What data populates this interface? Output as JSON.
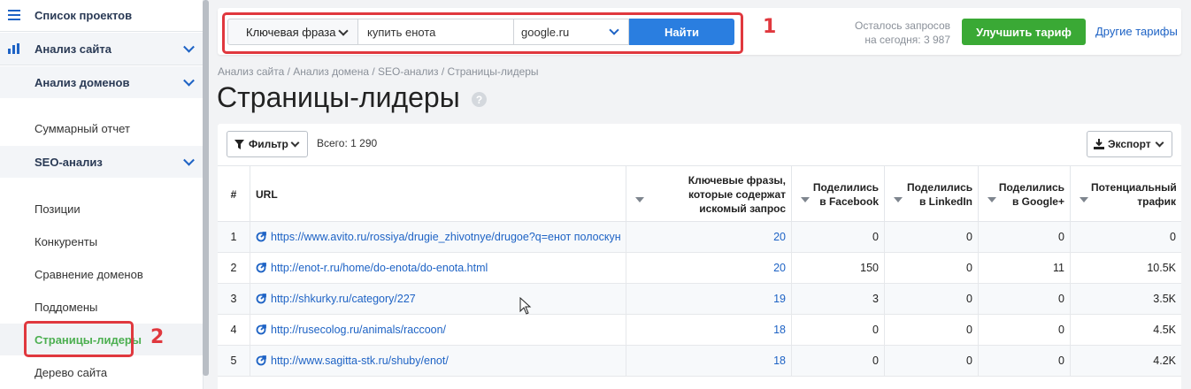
{
  "sidebar": {
    "projects": "Список проектов",
    "site_analysis": "Анализ сайта",
    "domain_analysis": "Анализ доменов",
    "summary": "Суммарный отчет",
    "seo_analysis": "SEO-анализ",
    "positions": "Позиции",
    "competitors": "Конкуренты",
    "domain_compare": "Сравнение доменов",
    "subdomains": "Поддомены",
    "leader_pages": "Страницы-лидеры",
    "site_tree": "Дерево сайта"
  },
  "annotations": {
    "one": "1",
    "two": "2"
  },
  "search": {
    "type_select": "Ключевая фраза",
    "query": "купить енота",
    "engine": "google.ru",
    "find_button": "Найти"
  },
  "topbar": {
    "remaining_line1": "Осталось запросов",
    "remaining_line2": "на сегодня: 3 987",
    "upgrade_button": "Улучшить тариф",
    "other_tariffs": "Другие тарифы"
  },
  "breadcrumb": "Анализ сайта / Анализ домена / SEO-анализ / Страницы-лидеры",
  "page_title": "Страницы-лидеры",
  "help": "?",
  "toolbar": {
    "filter": "Фильтр",
    "total": "Всего: 1 290",
    "export": "Экспорт"
  },
  "table": {
    "headers": {
      "idx": "#",
      "url": "URL",
      "keywords": "Ключевые фразы, которые содержат искомый запрос",
      "facebook": "Поделились в Facebook",
      "linkedin": "Поделились в LinkedIn",
      "google": "Поделились в Google+",
      "traffic": "Потенциальный трафик"
    },
    "rows": [
      {
        "idx": "1",
        "url": "https://www.avito.ru/rossiya/drugie_zhivotnye/drugoe?q=енот полоскун",
        "kw": "20",
        "fb": "0",
        "li": "0",
        "gp": "0",
        "tr": "0"
      },
      {
        "idx": "2",
        "url": "http://enot-r.ru/home/do-enota/do-enota.html",
        "kw": "20",
        "fb": "150",
        "li": "0",
        "gp": "11",
        "tr": "10.5K"
      },
      {
        "idx": "3",
        "url": "http://shkurky.ru/category/227",
        "kw": "19",
        "fb": "3",
        "li": "0",
        "gp": "0",
        "tr": "3.5K"
      },
      {
        "idx": "4",
        "url": "http://rusecolog.ru/animals/raccoon/",
        "kw": "18",
        "fb": "0",
        "li": "0",
        "gp": "0",
        "tr": "4.5K"
      },
      {
        "idx": "5",
        "url": "http://www.sagitta-stk.ru/shuby/enot/",
        "kw": "18",
        "fb": "0",
        "li": "0",
        "gp": "0",
        "tr": "4.2K"
      }
    ]
  },
  "colors": {
    "accent_blue": "#2a7ee0",
    "green": "#3aa935",
    "highlight_red": "#e0383e",
    "link": "#1e63c5"
  }
}
